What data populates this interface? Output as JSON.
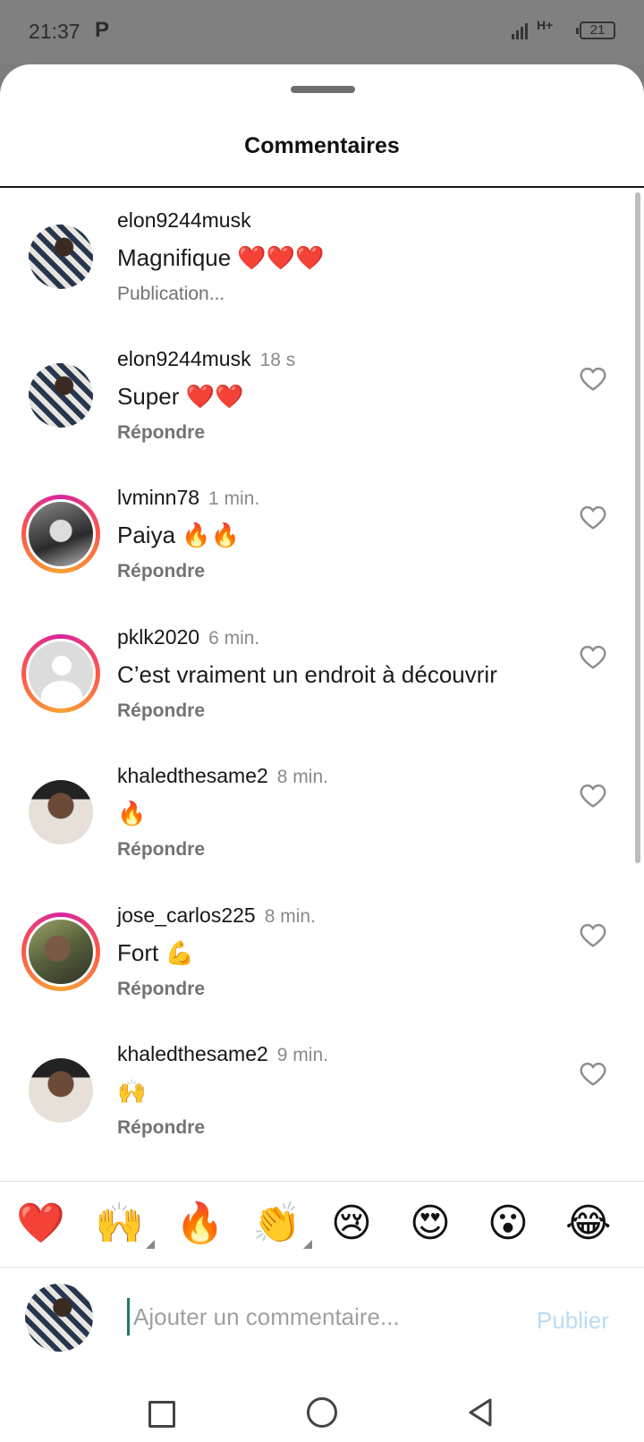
{
  "status_bar": {
    "time": "21:37",
    "app_badge": "P",
    "network": "H+",
    "battery": "21"
  },
  "sheet": {
    "title": "Commentaires"
  },
  "comments": [
    {
      "user": "elon9244musk",
      "time": "",
      "text": "Magnifique ❤️❤️❤️",
      "sub": "Publication...",
      "avatar": "photo-pattern",
      "ring": false,
      "liked": null
    },
    {
      "user": "elon9244musk",
      "time": "18 s",
      "text": "Super ❤️❤️",
      "sub": "Répondre",
      "avatar": "photo-pattern",
      "ring": false,
      "liked": false
    },
    {
      "user": "lvminn78",
      "time": "1 min.",
      "text": "Paiya 🔥🔥",
      "sub": "Répondre",
      "avatar": "photo-bw",
      "ring": true,
      "liked": false
    },
    {
      "user": "pklk2020",
      "time": "6 min.",
      "text": "C’est vraiment un endroit à découvrir",
      "sub": "Répondre",
      "avatar": "default-avatar",
      "ring": true,
      "liked": false
    },
    {
      "user": "khaledthesame2",
      "time": "8 min.",
      "text": "🔥",
      "sub": "Répondre",
      "avatar": "photo-khaled",
      "ring": false,
      "liked": false
    },
    {
      "user": "jose_carlos225",
      "time": "8 min.",
      "text": "Fort 💪",
      "sub": "Répondre",
      "avatar": "photo-jose",
      "ring": true,
      "liked": false
    },
    {
      "user": "khaledthesame2",
      "time": "9 min.",
      "text": "🙌",
      "sub": "Répondre",
      "avatar": "photo-khaled",
      "ring": false,
      "liked": false
    }
  ],
  "quick_reactions": [
    "❤️",
    "🙌",
    "🔥",
    "👏",
    "😢",
    "😍",
    "😮",
    "😂"
  ],
  "composer": {
    "placeholder": "Ajouter un commentaire...",
    "publish_label": "Publier"
  },
  "colors": {
    "publish_disabled": "#b9dcf6",
    "cursor": "#1b7a6e",
    "story_ring": "#d6249f"
  }
}
